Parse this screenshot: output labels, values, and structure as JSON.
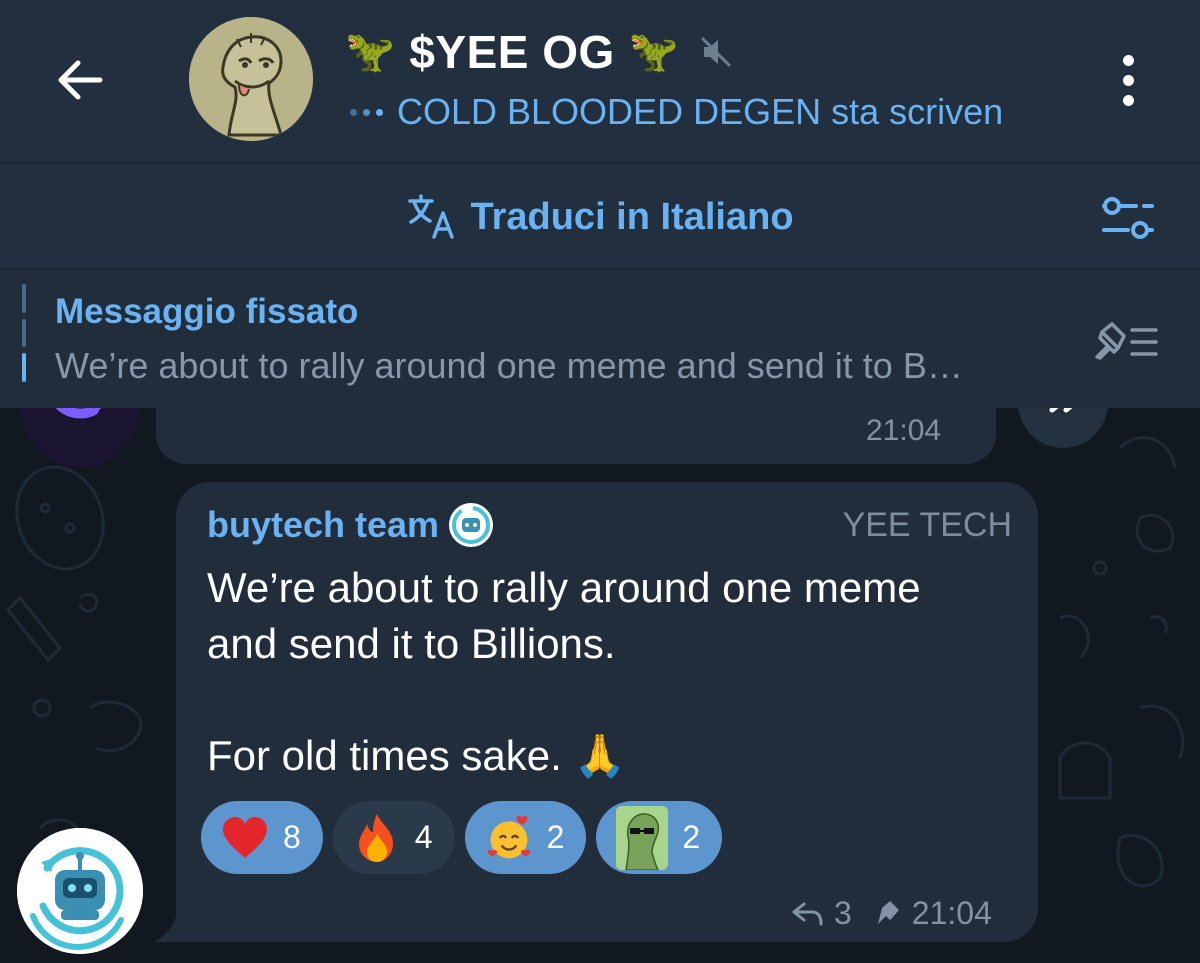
{
  "header": {
    "title": "$YEE OG",
    "title_emoji": "🦖",
    "status": "COLD BLOODED DEGEN sta scriven",
    "icons": [
      "back-arrow-icon",
      "dino-avatar",
      "mute-icon",
      "more-vert-icon"
    ]
  },
  "translate_bar": {
    "label": "Traduci in Italiano",
    "icons": [
      "translate-icon",
      "settings-sliders-icon"
    ]
  },
  "pinned": {
    "title": "Messaggio fissato",
    "text": "We’re about to rally around one meme and send it to B…",
    "icons": [
      "pin-list-icon"
    ]
  },
  "previous_message": {
    "time": "21:04"
  },
  "message": {
    "sender": "buytech team",
    "author_tag": "YEE TECH",
    "text": "We’re about to rally around one meme\nand send it to Billions.\n\nFor old times sake. 🙏",
    "reactions": [
      {
        "emoji": "❤️",
        "count": "8",
        "mine": true
      },
      {
        "emoji": "🔥",
        "count": "4",
        "mine": false
      },
      {
        "emoji": "🥰",
        "count": "2",
        "mine": true
      },
      {
        "emoji": "sticker",
        "count": "2",
        "mine": true
      }
    ],
    "replies": "3",
    "time": "21:04"
  },
  "colors": {
    "accent": "#6ab2f2",
    "header_bg": "#222f3f",
    "bubble_bg": "#212d3b",
    "chat_bg": "#111820",
    "reaction_mine": "#5d96cf"
  }
}
